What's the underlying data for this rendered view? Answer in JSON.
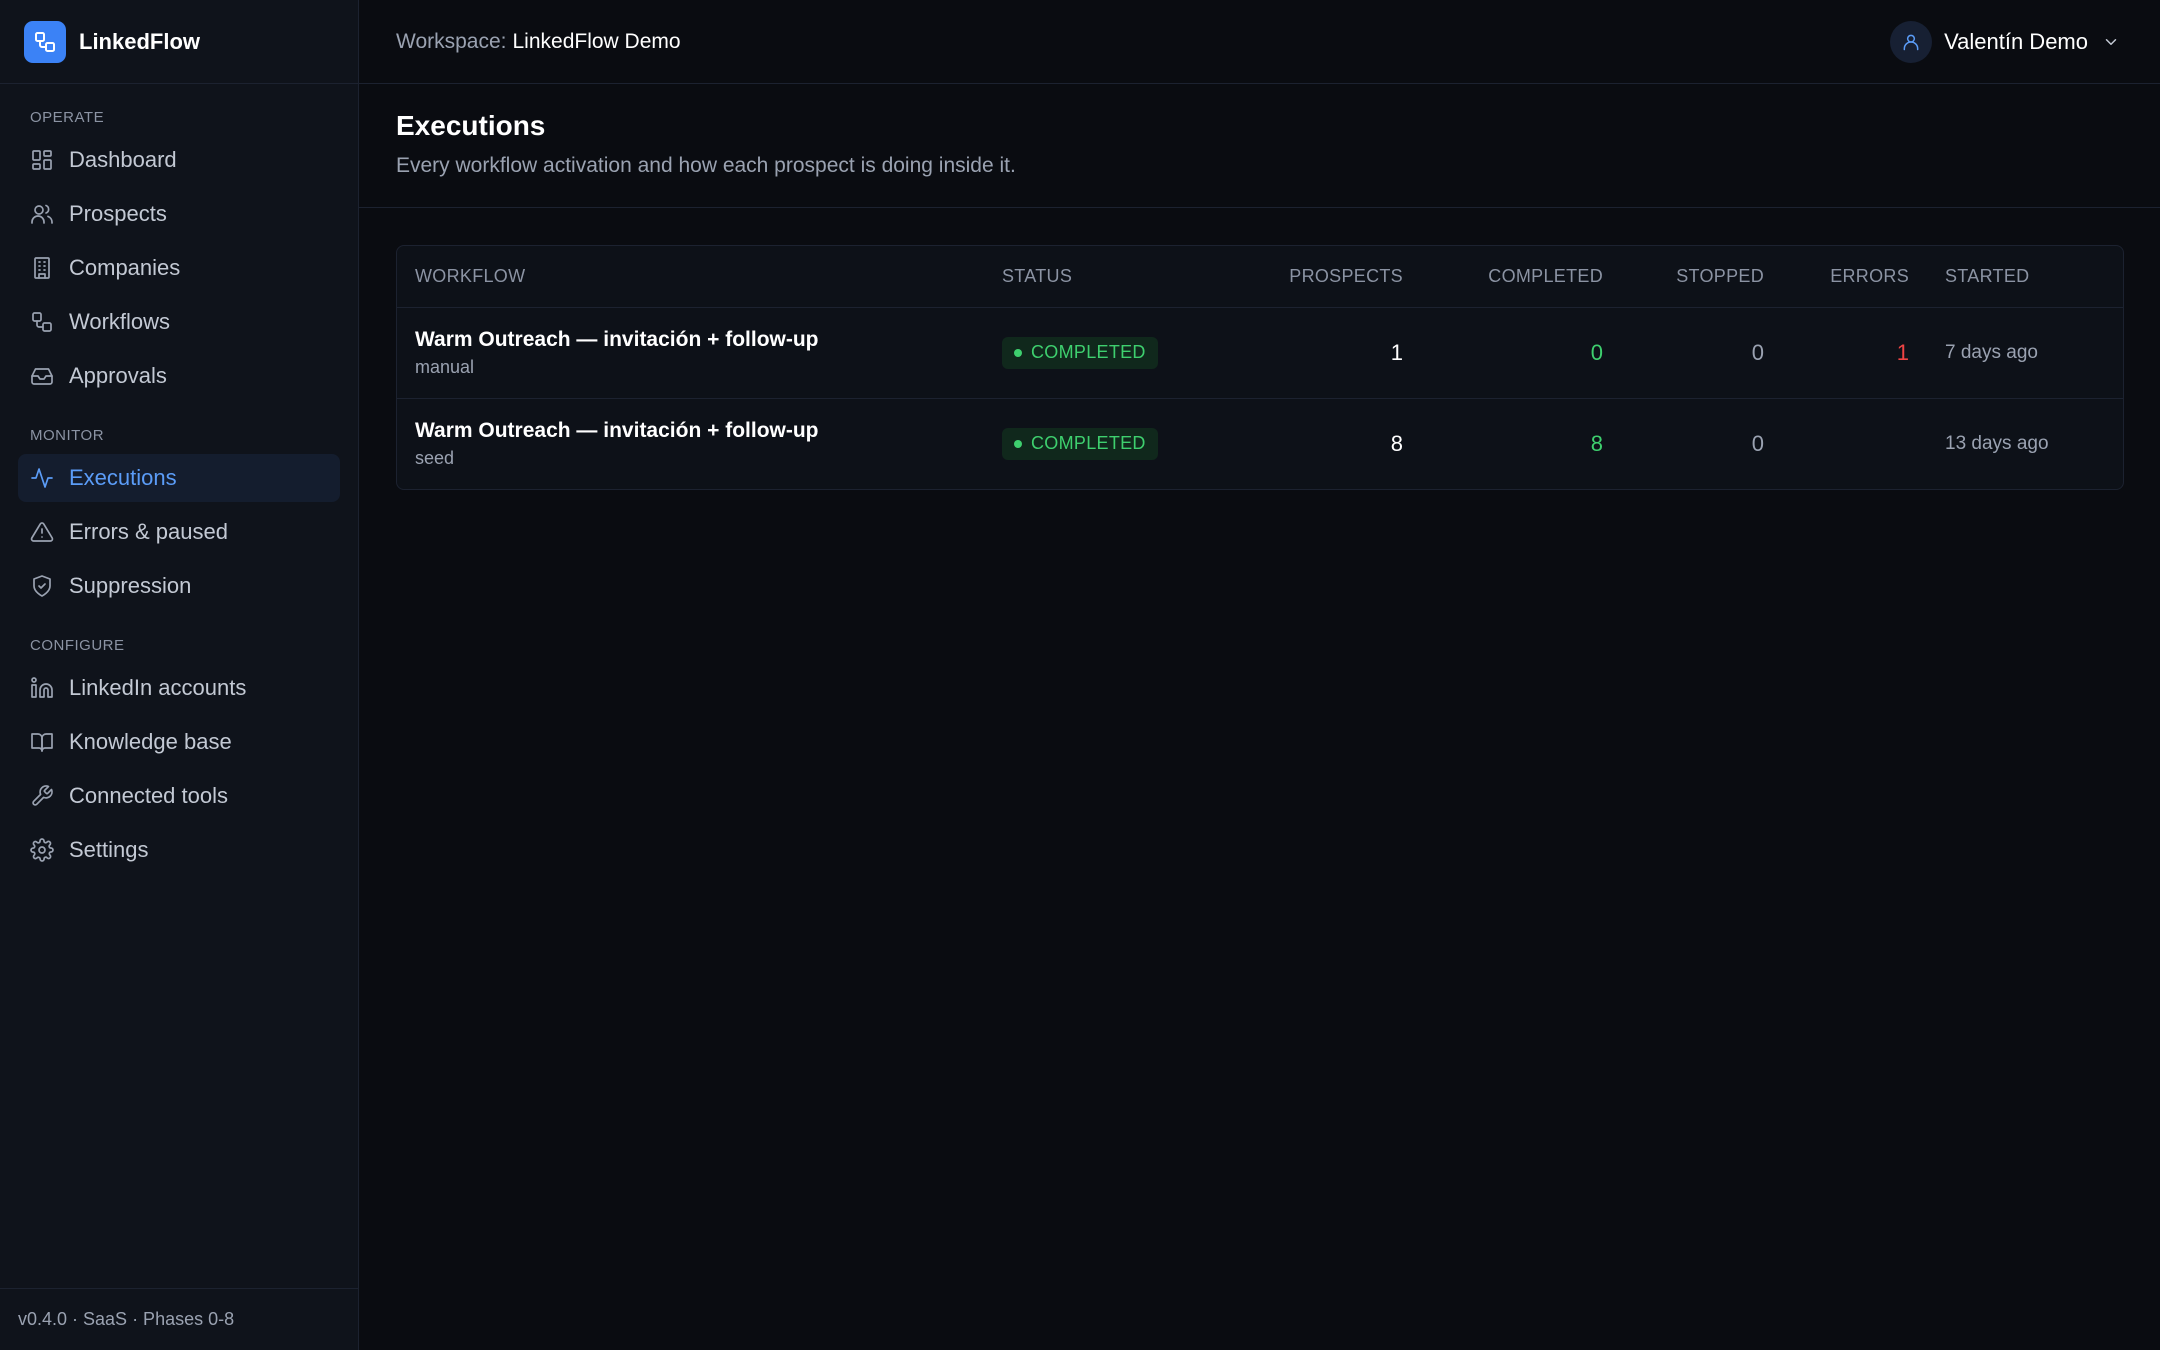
{
  "brand": {
    "name": "LinkedFlow"
  },
  "sidebar": {
    "sections": [
      {
        "label": "OPERATE",
        "items": [
          {
            "label": "Dashboard",
            "icon": "dashboard-icon"
          },
          {
            "label": "Prospects",
            "icon": "users-icon"
          },
          {
            "label": "Companies",
            "icon": "building-icon"
          },
          {
            "label": "Workflows",
            "icon": "workflow-icon"
          },
          {
            "label": "Approvals",
            "icon": "inbox-icon"
          }
        ]
      },
      {
        "label": "MONITOR",
        "items": [
          {
            "label": "Executions",
            "icon": "activity-icon",
            "active": true
          },
          {
            "label": "Errors & paused",
            "icon": "warning-icon"
          },
          {
            "label": "Suppression",
            "icon": "shield-icon"
          }
        ]
      },
      {
        "label": "CONFIGURE",
        "items": [
          {
            "label": "LinkedIn accounts",
            "icon": "linkedin-icon"
          },
          {
            "label": "Knowledge base",
            "icon": "book-icon"
          },
          {
            "label": "Connected tools",
            "icon": "wrench-icon"
          },
          {
            "label": "Settings",
            "icon": "gear-icon"
          }
        ]
      }
    ],
    "version": "v0.4.0 · SaaS · Phases 0-8"
  },
  "topbar": {
    "workspace_label": "Workspace:",
    "workspace_name": "LinkedFlow Demo",
    "user_name": "Valentín Demo"
  },
  "page": {
    "title": "Executions",
    "subtitle": "Every workflow activation and how each prospect is doing inside it."
  },
  "table": {
    "headers": {
      "workflow": "WORKFLOW",
      "status": "STATUS",
      "prospects": "PROSPECTS",
      "completed": "COMPLETED",
      "stopped": "STOPPED",
      "errors": "ERRORS",
      "started": "STARTED"
    },
    "rows": [
      {
        "workflow": "Warm Outreach — invitación + follow-up",
        "source": "manual",
        "status": "COMPLETED",
        "prospects": "1",
        "completed": "0",
        "stopped": "0",
        "errors": "1",
        "started": "7 days ago"
      },
      {
        "workflow": "Warm Outreach — invitación + follow-up",
        "source": "seed",
        "status": "COMPLETED",
        "prospects": "8",
        "completed": "8",
        "stopped": "0",
        "errors": "",
        "started": "13 days ago"
      }
    ]
  },
  "colors": {
    "accent": "#3b82f6",
    "success": "#3ecf6e",
    "error": "#ef4444"
  }
}
